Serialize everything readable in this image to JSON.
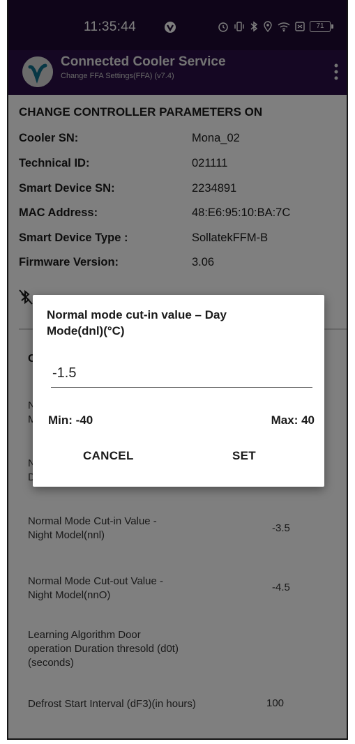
{
  "status_bar": {
    "time": "11:35:44",
    "battery": "71",
    "icons": [
      "vpn-icon",
      "alarm-icon",
      "vibrate-icon",
      "bluetooth-icon",
      "location-icon",
      "wifi-icon",
      "notification-box-icon",
      "battery-icon"
    ]
  },
  "app_bar": {
    "title": "Connected Cooler Service",
    "subtitle": "Change FFA Settings(FFA) (v7.4)"
  },
  "details": {
    "section_title": "CHANGE CONTROLLER PARAMETERS ON",
    "rows": [
      {
        "label": "Cooler SN:",
        "value": "Mona_02"
      },
      {
        "label": "Technical ID:",
        "value": "021111"
      },
      {
        "label": "Smart Device SN:",
        "value": "2234891"
      },
      {
        "label": "MAC Address:",
        "value": "48:E6:95:10:BA:7C"
      },
      {
        "label": "Smart Device Type  :",
        "value": "SollatekFFM-B"
      },
      {
        "label": "Firmware Version:",
        "value": "3.06"
      }
    ]
  },
  "params": {
    "co_label": "Co",
    "partial": [
      {
        "line1": "No",
        "line2": "M"
      },
      {
        "line1": "No",
        "line2": "Da"
      }
    ],
    "items": [
      {
        "label_line1": "Normal Mode Cut-in Value -",
        "label_line2": "Night Model(nnl)",
        "value": "-3.5"
      },
      {
        "label_line1": "Normal Mode Cut-out Value -",
        "label_line2": "Night Model(nnO)",
        "value": "-4.5"
      },
      {
        "label_line1": "Learning Algorithm Door",
        "label_line2": "operation Duration thresold (d0t)",
        "label_line3": "(seconds)",
        "value": ""
      },
      {
        "label_line1": "Defrost Start Interval (dF3)(in hours)",
        "value": "100"
      }
    ]
  },
  "dialog": {
    "title": "Normal mode cut-in value – Day Mode(dnl)(°C)",
    "input_value": "-1.5",
    "min_label": "Min: -40",
    "max_label": "Max:  40",
    "cancel_label": "CANCEL",
    "set_label": "SET"
  },
  "colors": {
    "status_bar_bg": "#1e0a33",
    "app_bar_bg": "#2a0f47",
    "logo_accent": "#0e6f8a"
  }
}
